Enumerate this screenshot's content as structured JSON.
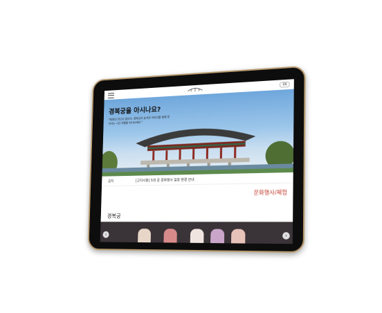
{
  "header": {
    "menu_icon": "hamburger-menu-icon",
    "language_label": "EN"
  },
  "hero": {
    "title": "경복궁을 아시나요?",
    "description": "\"600년 전으로 돌아가, 경복궁의 숨겨진 이야기를 함께 찾아가는 시간 여행을 떠나보세요.\""
  },
  "notice": {
    "label": "공지",
    "text": "[고지사항] 5대 궁 문화행사 일정 변경 안내"
  },
  "sections": {
    "events_link": "문화행사/체험",
    "gallery_title": "경복궁"
  },
  "gallery": {
    "prev_icon": "arrow-left-icon",
    "next_icon": "arrow-right-icon"
  },
  "colors": {
    "accent": "#c0392b",
    "frame": "#b79a6e",
    "bezel": "#0d0d0d"
  }
}
